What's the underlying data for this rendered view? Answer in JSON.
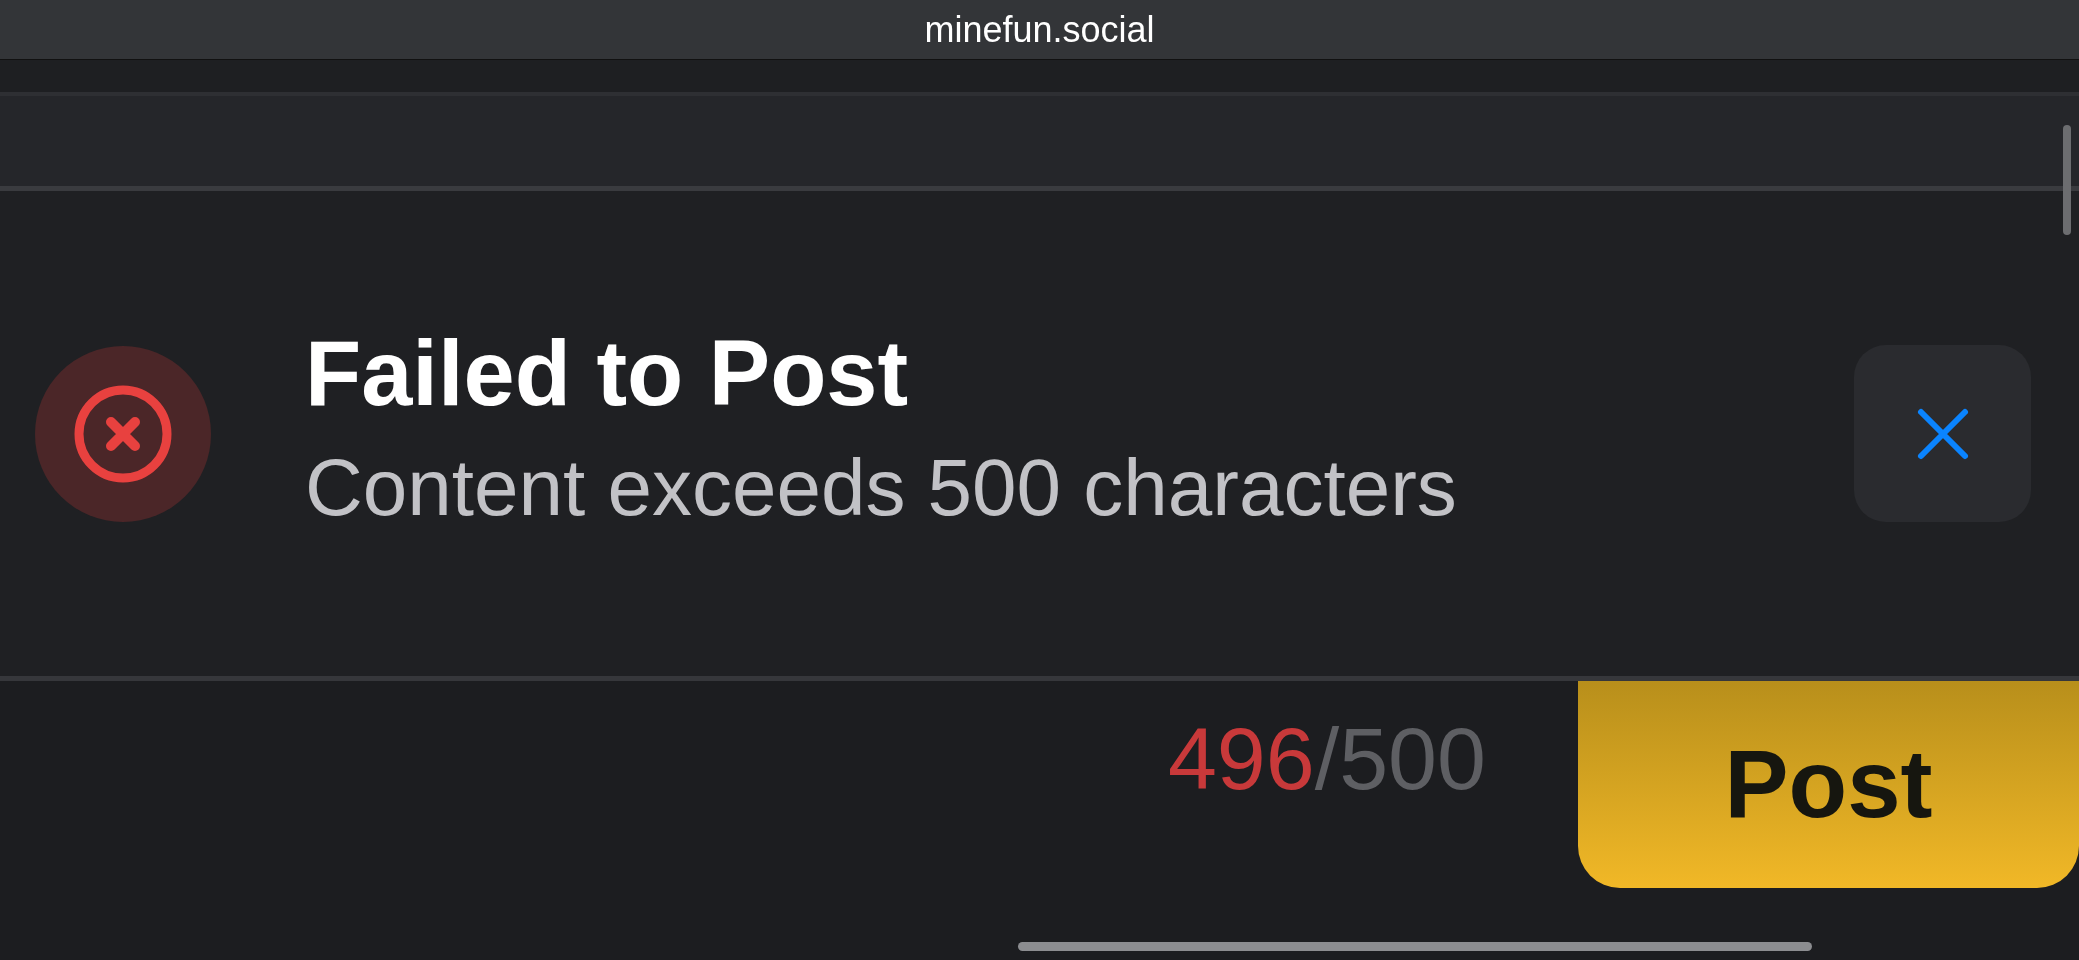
{
  "browser": {
    "address": "minefun.social"
  },
  "toast": {
    "kind": "error",
    "title": "Failed to Post",
    "message": "Content exceeds 500 characters"
  },
  "composer": {
    "count": "496",
    "limit": "/500",
    "over_limit": true,
    "post_button": "Post"
  }
}
